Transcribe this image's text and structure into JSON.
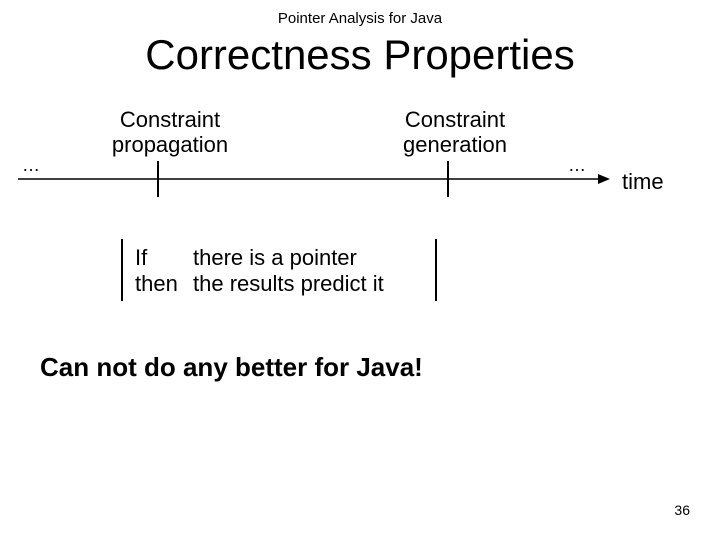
{
  "header": "Pointer Analysis for Java",
  "title": "Correctness Properties",
  "timeline": {
    "label_propagation_line1": "Constraint",
    "label_propagation_line2": "propagation",
    "label_generation_line1": "Constraint",
    "label_generation_line2": "generation",
    "ellipsis_left": "…",
    "ellipsis_right": "…",
    "time_label": "time"
  },
  "if_then": {
    "if_kw": "If",
    "if_body": "there is a pointer",
    "then_kw": "then",
    "then_body": "the results predict it"
  },
  "bottom_statement": "Can not do any better for Java!",
  "page_number": "36"
}
